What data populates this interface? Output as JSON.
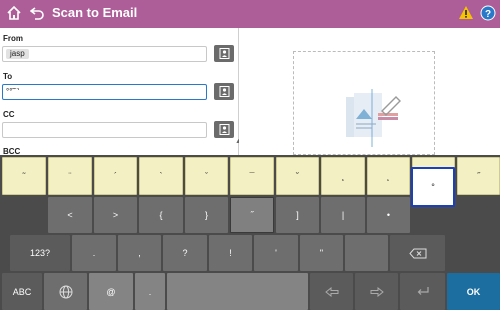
{
  "header": {
    "title": "Scan to Email",
    "colors": {
      "bar": "#ad5e98",
      "warning": "#f5c300",
      "help": "#2a78c8"
    }
  },
  "form": {
    "from": {
      "label": "From",
      "chip": "jasp"
    },
    "to": {
      "label": "To",
      "value": "°°˜¨‘"
    },
    "cc": {
      "label": "CC",
      "value": ""
    },
    "bcc": {
      "label": "BCC"
    }
  },
  "keyboard": {
    "accent_row": [
      "˜",
      "¨",
      "´",
      "`",
      "ˇ",
      "¯",
      "˘",
      "¸",
      "˛",
      "˙",
      "˝"
    ],
    "row2": [
      "<",
      ">",
      "{",
      "}",
      "˝",
      "]",
      "|",
      "•",
      "°"
    ],
    "row3": [
      "123?",
      ".",
      ",",
      "?",
      "!",
      "'",
      "\""
    ],
    "row4": {
      "abc": "ABC",
      "at": "@",
      "dot": ".",
      "ok": "OK"
    }
  }
}
